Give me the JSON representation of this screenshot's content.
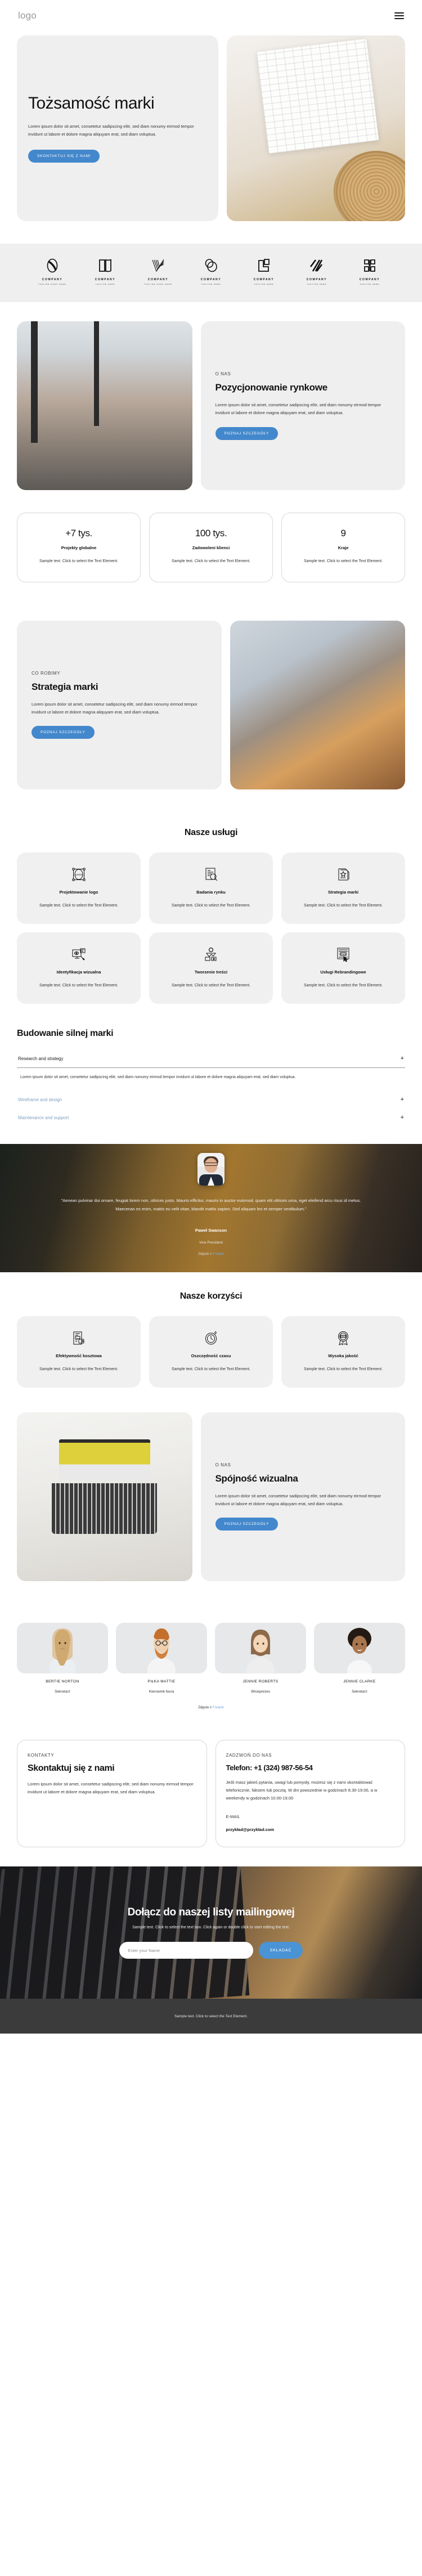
{
  "header": {
    "logo": "logo",
    "menu_icon": "hamburger-icon"
  },
  "hero": {
    "title": "Tożsamość marki",
    "paragraph": "Lorem ipsum dolor sit amet, consetetur sadipscing elitr, sed diam nonumy eirmod tempor invidunt ut labore et dolore magna aliquyam erat, sed diam voluptua.",
    "cta": "SKONTAKTUJ SIĘ Z NAMI"
  },
  "logos": [
    {
      "name": "COMPANY",
      "tagline": "TAGLINE GOES HERE",
      "mark": "oval-mono-icon"
    },
    {
      "name": "COMPANY",
      "tagline": "TAGLINE HERE",
      "mark": "open-book-icon"
    },
    {
      "name": "COMPANY",
      "tagline": "TAGLINE GOES HERE",
      "mark": "check-lines-icon"
    },
    {
      "name": "COMPANY",
      "tagline": "TAGLINE HERE",
      "mark": "double-circle-icon"
    },
    {
      "name": "COMPANY",
      "tagline": "TAGLINE HERE",
      "mark": "square-corner-icon"
    },
    {
      "name": "COMPANY",
      "tagline": "TAGLINE HERE",
      "mark": "slash-lines-icon"
    },
    {
      "name": "COMPANY",
      "tagline": "TAGLINE HERE",
      "mark": "block-letter-icon"
    }
  ],
  "about_market": {
    "eyebrow": "O NAS",
    "title": "Pozycjonowanie rynkowe",
    "paragraph": "Lorem ipsum dolor sit amet, consetetur sadipscing elitr, sed diam nonumy eirmod tempor invidunt ut labore et dolore magna aliquyam erat, sed diam voluptua.",
    "cta": "POZNAJ SZCZEGÓŁY"
  },
  "stats": [
    {
      "number": "+7 tys.",
      "label": "Projekty globalne",
      "desc": "Sample text. Click to select the Text Element."
    },
    {
      "number": "100 tys.",
      "label": "Zadowoleni klienci",
      "desc": "Sample text. Click to select the Text Element."
    },
    {
      "number": "9",
      "label": "Kraje",
      "desc": "Sample text. Click to select the Text Element."
    }
  ],
  "strategy": {
    "eyebrow": "CO ROBIMY",
    "title": "Strategia marki",
    "paragraph": "Lorem ipsum dolor sit amet, consetetur sadipscing elitr, sed diam nonumy eirmod tempor invidunt ut labore et dolore magna aliquyam erat, sed diam voluptua.",
    "cta": "POZNAJ SZCZEGÓŁY"
  },
  "services": {
    "title": "Nasze usługi",
    "items": [
      {
        "title": "Projektowanie logo",
        "desc": "Sample text. Click to select the Text Element.",
        "icon": "logo-design-icon"
      },
      {
        "title": "Badania rynku",
        "desc": "Sample text. Click to select the Text Element.",
        "icon": "market-research-icon"
      },
      {
        "title": "Strategia marki",
        "desc": "Sample text. Click to select the Text Element.",
        "icon": "brand-strategy-icon"
      },
      {
        "title": "Identyfikacja wizualna",
        "desc": "Sample text. Click to select the Text Element.",
        "icon": "visual-identity-icon"
      },
      {
        "title": "Tworzenie treści",
        "desc": "Sample text. Click to select the Text Element.",
        "icon": "content-creation-icon"
      },
      {
        "title": "Usługi Rebrandingowe",
        "desc": "Sample text. Click to select the Text Element.",
        "icon": "rebranding-icon"
      }
    ]
  },
  "accordion": {
    "title": "Budowanie silnej marki",
    "items": [
      {
        "label": "Research and strategy",
        "state": "open",
        "toggle": "+",
        "body": "Lorem ipsum dolor sit amet, consetetur sadipscing elitr, sed diam nonumy eirmod tempor invidunt ut labore et dolore magna aliquyam erat, sed diam voluptua."
      },
      {
        "label": "Wireframe and design",
        "state": "collapsed",
        "toggle": "+",
        "body": ""
      },
      {
        "label": "Maintenance and support",
        "state": "collapsed",
        "toggle": "+",
        "body": ""
      }
    ]
  },
  "testimonial": {
    "quote": "\"Aenean pulvinar dui ornare, feugiat lorem non, ultrices justo. Mauris efficitur, mauris in auctor euismod, quam elit ultrices urna, eget eleifend arcu risus id metus. Maecenas ex enim, mattis eu velit vitae, blandit mattis sapien. Sed aliquam leo et semper vestibulum.\"",
    "name": "Paweł Swanson",
    "role": "Vice President",
    "credit_prefix": "Zdjęcie z ",
    "credit_link": "Freepik"
  },
  "benefits": {
    "title": "Nasze korzyści",
    "items": [
      {
        "title": "Efektywność kosztowa",
        "desc": "Sample text. Click to select the Text Element.",
        "icon": "cost-efficiency-icon"
      },
      {
        "title": "Oszczędność czasu",
        "desc": "Sample text. Click to select the Text Element.",
        "icon": "clock-icon"
      },
      {
        "title": "Wysoka jakość",
        "desc": "Sample text. Click to select the Text Element.",
        "icon": "quality-badge-icon"
      }
    ]
  },
  "visual": {
    "eyebrow": "O NAS",
    "title": "Spójność wizualna",
    "paragraph": "Lorem ipsum dolor sit amet, consetetur sadipscing elitr, sed diam nonumy eirmod tempor invidunt ut labore et dolore magna aliquyam erat, sed diam voluptua.",
    "cta": "POZNAJ SZCZEGÓŁY"
  },
  "team": {
    "members": [
      {
        "name": "BERTIE NORTON",
        "role": "Sekretarz"
      },
      {
        "name": "PIŁKA MATTIE",
        "role": "Kierownik biura"
      },
      {
        "name": "JENNIE ROBERTS",
        "role": "Wiceprezes"
      },
      {
        "name": "JENNIE CLARKE",
        "role": "Sekretarz"
      }
    ],
    "credit_prefix": "Zdjęcie z ",
    "credit_link": "Freepik"
  },
  "contact": {
    "eyebrow": "KONTAKTY",
    "title": "Skontaktuj się z nami",
    "paragraph": "Lorem ipsum dolor sit amet, consetetur sadipscing elitr, sed diam nonumy eirmod tempor invidunt ut labore et dolore magna aliquyam erat, sed diam voluptua.",
    "call_eyebrow": "ZADZWOŃ DO NAS",
    "phone": "Telefon: +1 (324) 987-56-54",
    "hours": "Jeśli masz jakieś pytania, uwagi lub pomysły, możesz się z nami skontaktować telefonicznie, faksem lub pocztą. W dni powszednie w godzinach 8.30-19.00, a w weekendy w godzinach 10.00-19.00",
    "email_label": "E-MAIL",
    "email": "przykład@przykład.com"
  },
  "newsletter": {
    "title": "Dołącz do naszej listy mailingowej",
    "subtitle": "Sample text. Click to select the text box. Click again or double click to start editing the text.",
    "input_placeholder": "Enter your Name",
    "input_value": "",
    "button": "SKŁADAĆ"
  },
  "footer": {
    "text": "Sample text. Click to select the Text Element."
  },
  "colors": {
    "accent": "#4388cc",
    "accent_light": "#4a93d4",
    "panel": "#efefef",
    "footer_bg": "#3b3b3b",
    "link": "#7ca9d8"
  }
}
